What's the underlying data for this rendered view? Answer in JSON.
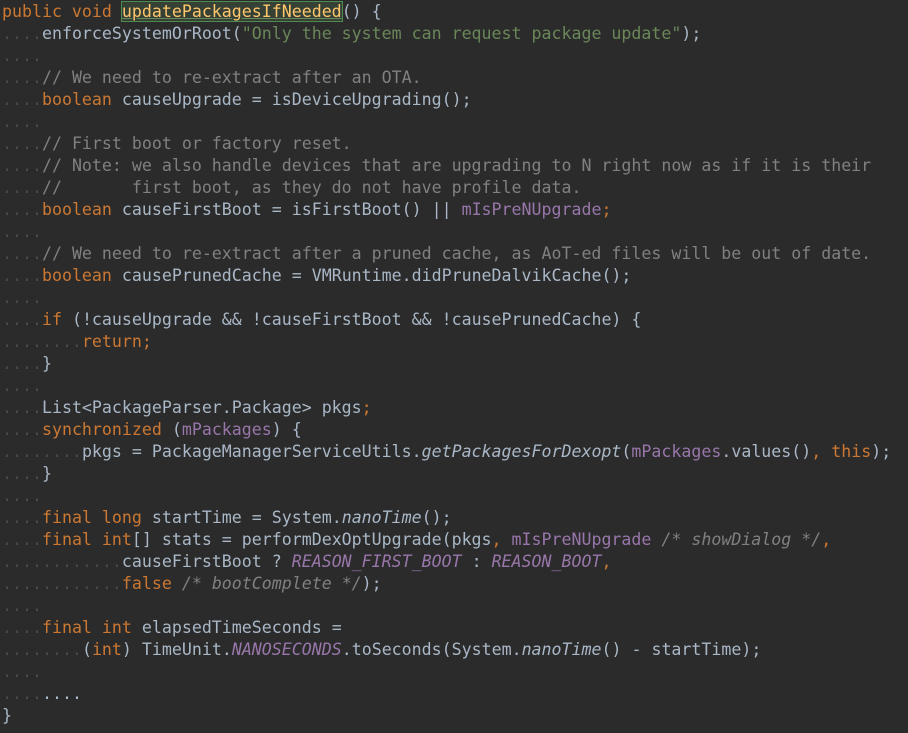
{
  "editor": {
    "lines": [
      [
        [
          "kw",
          "public void "
        ],
        [
          "hl",
          "updatePackagesIfNeeded"
        ],
        [
          "plain",
          "() {"
        ]
      ],
      [
        [
          "ws",
          "...."
        ],
        [
          "plain",
          "enforceSystemOrRoot("
        ],
        [
          "str",
          "\"Only the system can request package update\""
        ],
        [
          "plain",
          ");"
        ]
      ],
      [
        [
          "ws",
          "...."
        ]
      ],
      [
        [
          "ws",
          "...."
        ],
        [
          "cm",
          "// We need to re-extract after an OTA."
        ]
      ],
      [
        [
          "ws",
          "...."
        ],
        [
          "kw",
          "boolean "
        ],
        [
          "plain",
          "causeUpgrade = isDeviceUpgrading();"
        ]
      ],
      [
        [
          "ws",
          "...."
        ]
      ],
      [
        [
          "ws",
          "...."
        ],
        [
          "cm",
          "// First boot or factory reset."
        ]
      ],
      [
        [
          "ws",
          "...."
        ],
        [
          "cm",
          "// Note: we also handle devices that are upgrading to N right now as if it is their"
        ]
      ],
      [
        [
          "ws",
          "...."
        ],
        [
          "cm",
          "//       first boot, as they do not have profile data."
        ]
      ],
      [
        [
          "ws",
          "...."
        ],
        [
          "kw",
          "boolean "
        ],
        [
          "plain",
          "causeFirstBoot = isFirstBoot() || "
        ],
        [
          "field",
          "mIsPreNUpgrade"
        ],
        [
          "kw",
          ";"
        ]
      ],
      [
        [
          "ws",
          "...."
        ]
      ],
      [
        [
          "ws",
          "...."
        ],
        [
          "cm",
          "// We need to re-extract after a pruned cache, as AoT-ed files will be out of date."
        ]
      ],
      [
        [
          "ws",
          "...."
        ],
        [
          "kw",
          "boolean "
        ],
        [
          "plain",
          "causePrunedCache = VMRuntime."
        ],
        [
          "plain",
          "didPruneDalvikCache();"
        ]
      ],
      [
        [
          "ws",
          "...."
        ]
      ],
      [
        [
          "ws",
          "...."
        ],
        [
          "kw",
          "if "
        ],
        [
          "plain",
          "(!causeUpgrade && !causeFirstBoot && !causePrunedCache) {"
        ]
      ],
      [
        [
          "ws",
          "........"
        ],
        [
          "kw",
          "return;"
        ]
      ],
      [
        [
          "ws",
          "...."
        ],
        [
          "plain",
          "}"
        ]
      ],
      [
        [
          "ws",
          "...."
        ]
      ],
      [
        [
          "ws",
          "...."
        ],
        [
          "plain",
          "List<PackageParser.Package> pkgs"
        ],
        [
          "kw",
          ";"
        ]
      ],
      [
        [
          "ws",
          "...."
        ],
        [
          "kw",
          "synchronized "
        ],
        [
          "plain",
          "("
        ],
        [
          "field",
          "mPackages"
        ],
        [
          "plain",
          ") {"
        ]
      ],
      [
        [
          "ws",
          "........"
        ],
        [
          "plain",
          "pkgs = PackageManagerServiceUtils."
        ],
        [
          "static",
          "getPackagesForDexopt"
        ],
        [
          "plain",
          "("
        ],
        [
          "field",
          "mPackages"
        ],
        [
          "plain",
          ".values()"
        ],
        [
          "kw",
          ", this"
        ],
        [
          "plain",
          ");"
        ]
      ],
      [
        [
          "ws",
          "...."
        ],
        [
          "plain",
          "}"
        ]
      ],
      [
        [
          "ws",
          "...."
        ]
      ],
      [
        [
          "ws",
          "...."
        ],
        [
          "kw",
          "final long "
        ],
        [
          "plain",
          "startTime = System."
        ],
        [
          "static",
          "nanoTime"
        ],
        [
          "plain",
          "();"
        ]
      ],
      [
        [
          "ws",
          "...."
        ],
        [
          "kw",
          "final int"
        ],
        [
          "plain",
          "[] stats = performDexOptUpgrade(pkgs"
        ],
        [
          "kw",
          ", "
        ],
        [
          "field",
          "mIsPreNUpgrade "
        ],
        [
          "cm it",
          "/* showDialog */"
        ],
        [
          "kw",
          ","
        ]
      ],
      [
        [
          "ws",
          "............"
        ],
        [
          "plain",
          "causeFirstBoot ? "
        ],
        [
          "field it",
          "REASON_FIRST_BOOT"
        ],
        [
          "plain",
          " : "
        ],
        [
          "field it",
          "REASON_BOOT"
        ],
        [
          "kw",
          ","
        ]
      ],
      [
        [
          "ws",
          "............"
        ],
        [
          "kw",
          "false "
        ],
        [
          "cm it",
          "/* bootComplete */"
        ],
        [
          "plain",
          ");"
        ]
      ],
      [
        [
          "ws",
          "...."
        ]
      ],
      [
        [
          "ws",
          "...."
        ],
        [
          "kw",
          "final int "
        ],
        [
          "plain",
          "elapsedTimeSeconds ="
        ]
      ],
      [
        [
          "ws",
          "........"
        ],
        [
          "plain",
          "("
        ],
        [
          "kw",
          "int"
        ],
        [
          "plain",
          ") TimeUnit."
        ],
        [
          "field it",
          "NANOSECONDS"
        ],
        [
          "plain",
          ".toSeconds(System."
        ],
        [
          "static",
          "nanoTime"
        ],
        [
          "plain",
          "() - startTime);"
        ]
      ],
      [
        [
          "ws",
          "...."
        ]
      ],
      [
        [
          "ws",
          "...."
        ],
        [
          "plain",
          "...."
        ]
      ],
      [
        [
          "plain",
          "}"
        ]
      ]
    ]
  }
}
